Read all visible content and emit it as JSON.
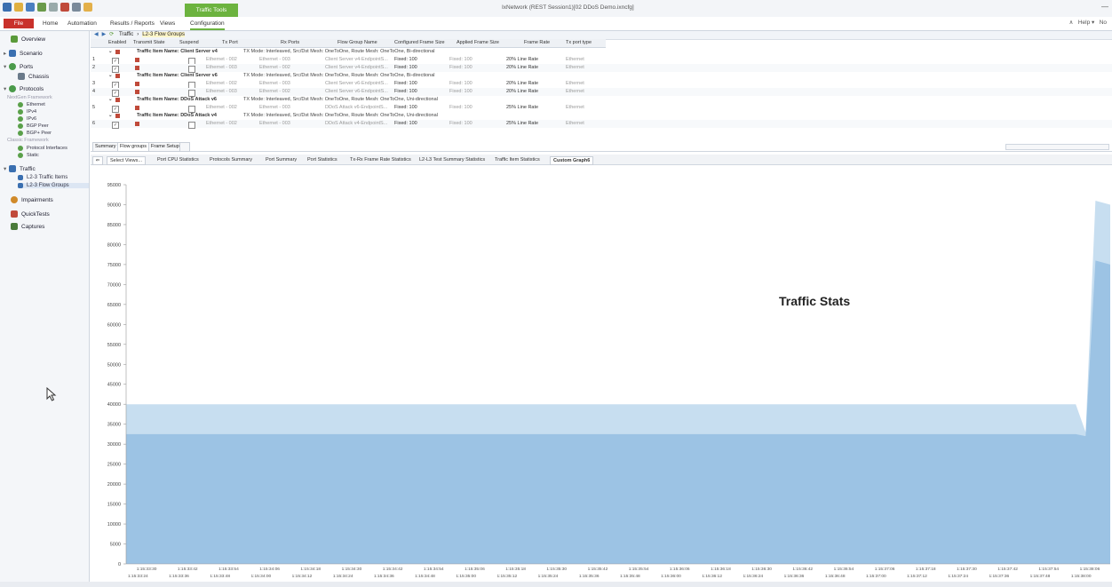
{
  "titlebar": {
    "context_tab": "Traffic Tools",
    "window_title": "IxNetwork (REST Session1)[02 DDoS Demo.ixncfg]",
    "controls": "—"
  },
  "menubar": {
    "file": "File",
    "tabs": [
      "Home",
      "Automation",
      "Results / Reports",
      "Views",
      "Configuration"
    ],
    "help": "Help ▾",
    "right_label": "No",
    "up_icon": "∧"
  },
  "sidebar": {
    "items": [
      {
        "label": "Overview",
        "icon": "overview-icon",
        "color": "#5a9a3a"
      },
      {
        "label": "Scenario",
        "icon": "scenario-icon",
        "color": "#3a6fb0"
      },
      {
        "label": "Ports",
        "icon": "ports-icon",
        "color": "#4a9a4a"
      },
      {
        "label": "Chassis",
        "icon": "chassis-icon",
        "color": "#6a7a8a"
      },
      {
        "label": "Protocols",
        "icon": "protocols-icon",
        "color": "#4a9a4a"
      },
      {
        "label": "NextGen Framework"
      },
      {
        "label": "Ethernet",
        "icon": "ethernet-icon",
        "color": "#5aa04a"
      },
      {
        "label": "IPv4",
        "icon": "ipv4-icon",
        "color": "#5aa04a"
      },
      {
        "label": "IPv6",
        "icon": "ipv6-icon",
        "color": "#5aa04a"
      },
      {
        "label": "BGP Peer",
        "icon": "bgp-peer-icon",
        "color": "#5aa04a"
      },
      {
        "label": "BGP+ Peer",
        "icon": "bgp-plus-peer-icon",
        "color": "#5aa04a"
      },
      {
        "label": "Classic Framework"
      },
      {
        "label": "Protocol Interfaces",
        "icon": "protocol-interfaces-icon",
        "color": "#5aa04a"
      },
      {
        "label": "Static",
        "icon": "static-icon",
        "color": "#5aa04a"
      },
      {
        "label": "Traffic",
        "icon": "traffic-icon",
        "color": "#3a6fb0"
      },
      {
        "label": "L2-3 Traffic Items",
        "icon": "traffic-items-icon",
        "color": "#3a6fb0"
      },
      {
        "label": "L2-3 Flow Groups",
        "icon": "flow-groups-icon",
        "color": "#3a6fb0"
      },
      {
        "label": "Impairments",
        "icon": "impairments-icon",
        "color": "#d08a2a"
      },
      {
        "label": "QuickTests",
        "icon": "quicktests-icon",
        "color": "#c04a3a"
      },
      {
        "label": "Captures",
        "icon": "captures-icon",
        "color": "#4a7a3a"
      }
    ]
  },
  "breadcrumb": {
    "items": [
      "Traffic",
      "L2-3 Flow Groups"
    ],
    "sep": "›"
  },
  "grid": {
    "headers": [
      "Enabled",
      "Transmit State",
      "Suspend",
      "Tx Port",
      "Rx Ports",
      "Flow Group Name",
      "Configured Frame Size",
      "Applied Frame Size",
      "Frame Rate",
      "Tx port type"
    ],
    "groups": [
      {
        "name": "Traffic Item Name: Client Server v4",
        "desc": "TX Mode: Interleaved, Src/Dst Mesh: OneToOne, Route Mesh: OneToOne, Bi-directional",
        "rows": [
          {
            "num": "1",
            "tx": "Ethernet - 002",
            "rx": "Ethernet - 003",
            "fg": "Client Server v4-EndpointS...",
            "cfs": "Fixed: 100",
            "afs": "Fixed: 100",
            "rate": "20% Line Rate",
            "type": "Ethernet"
          },
          {
            "num": "2",
            "tx": "Ethernet - 003",
            "rx": "Ethernet - 002",
            "fg": "Client Server v4-EndpointS...",
            "cfs": "Fixed: 100",
            "afs": "Fixed: 100",
            "rate": "20% Line Rate",
            "type": "Ethernet"
          }
        ]
      },
      {
        "name": "Traffic Item Name: Client Server v6",
        "desc": "TX Mode: Interleaved, Src/Dst Mesh: OneToOne, Route Mesh: OneToOne, Bi-directional",
        "rows": [
          {
            "num": "3",
            "tx": "Ethernet - 002",
            "rx": "Ethernet - 003",
            "fg": "Client Server v6-EndpointS...",
            "cfs": "Fixed: 100",
            "afs": "Fixed: 100",
            "rate": "20% Line Rate",
            "type": "Ethernet"
          },
          {
            "num": "4",
            "tx": "Ethernet - 003",
            "rx": "Ethernet - 002",
            "fg": "Client Server v6-EndpointS...",
            "cfs": "Fixed: 100",
            "afs": "Fixed: 100",
            "rate": "20% Line Rate",
            "type": "Ethernet"
          }
        ]
      },
      {
        "name": "Traffic Item Name: DDoS Attack v6",
        "desc": "TX Mode: Interleaved, Src/Dst Mesh: OneToOne, Route Mesh: OneToOne, Uni-directional",
        "rows": [
          {
            "num": "5",
            "tx": "Ethernet - 002",
            "rx": "Ethernet - 003",
            "fg": "DDoS Attack v6-EndpointS...",
            "cfs": "Fixed: 100",
            "afs": "Fixed: 100",
            "rate": "25% Line Rate",
            "type": "Ethernet"
          }
        ]
      },
      {
        "name": "Traffic Item Name: DDoS Attack v4",
        "desc": "TX Mode: Interleaved, Src/Dst Mesh: OneToOne, Route Mesh: OneToOne, Uni-directional",
        "rows": [
          {
            "num": "6",
            "tx": "Ethernet - 002",
            "rx": "Ethernet - 003",
            "fg": "DDoS Attack v4-EndpointS...",
            "cfs": "Fixed: 100",
            "afs": "Fixed: 100",
            "rate": "25% Line Rate",
            "type": "Ethernet"
          }
        ]
      }
    ]
  },
  "subtabs": [
    "Summary",
    "Flow groups",
    "Frame Setup"
  ],
  "stat_tabs": {
    "select": "Select Views...",
    "tabs": [
      "Port CPU Statistics",
      "Protocols Summary",
      "Port Summary",
      "Port Statistics",
      "Tx-Rx Frame Rate Statistics",
      "L2-L3 Test Summary Statistics",
      "Traffic Item Statistics",
      "Custom Graph6"
    ],
    "active_index": 7
  },
  "chart_data": {
    "type": "area",
    "title": "Traffic Stats",
    "ylim": [
      0,
      95000
    ],
    "yticks": [
      0,
      5000,
      10000,
      15000,
      20000,
      25000,
      30000,
      35000,
      40000,
      45000,
      50000,
      55000,
      60000,
      65000,
      70000,
      75000,
      80000,
      85000,
      90000,
      95000
    ],
    "x_top": [
      "1:15:33:30",
      "1:15:33:42",
      "1:15:33:54",
      "1:15:34:06",
      "1:15:34:18",
      "1:15:34:30",
      "1:15:34:42",
      "1:15:34:54",
      "1:15:35:06",
      "1:15:35:18",
      "1:15:35:30",
      "1:15:35:42",
      "1:15:35:54",
      "1:15:36:06",
      "1:15:36:18",
      "1:15:36:30",
      "1:15:36:42",
      "1:15:36:54",
      "1:15:37:06",
      "1:15:37:18",
      "1:15:37:30",
      "1:15:37:42",
      "1:15:37:54",
      "1:15:38:06"
    ],
    "x_bottom": [
      "1:15:33:24",
      "1:15:33:36",
      "1:15:33:48",
      "1:15:34:00",
      "1:15:34:12",
      "1:15:34:24",
      "1:15:34:36",
      "1:15:34:48",
      "1:15:35:00",
      "1:15:35:12",
      "1:15:35:24",
      "1:15:35:36",
      "1:15:35:48",
      "1:15:36:00",
      "1:15:36:12",
      "1:15:36:24",
      "1:15:36:36",
      "1:15:36:48",
      "1:15:37:00",
      "1:15:37:12",
      "1:15:37:24",
      "1:15:37:36",
      "1:15:37:48",
      "1:15:38:00"
    ],
    "series": [
      {
        "color": "#c7def0",
        "t": [
          0,
          0.965,
          0.975,
          0.985,
          1.0
        ],
        "values": [
          40000,
          40000,
          33000,
          91000,
          90000
        ]
      },
      {
        "color": "#9cc3e4",
        "t": [
          0,
          0.965,
          0.975,
          0.985,
          1.0
        ],
        "values": [
          32500,
          32500,
          32000,
          76000,
          75000
        ]
      }
    ]
  }
}
